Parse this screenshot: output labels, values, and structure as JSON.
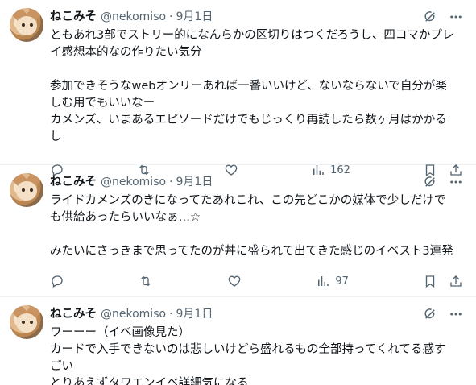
{
  "tweets": [
    {
      "name": "ねこみそ",
      "handle": "@nekomiso",
      "dot": "·",
      "date": "9月1日",
      "text": "ともあれ3部でストリー的になんらかの区切りはつくだろうし、四コマかプレイ感想本的なの作りたい気分\n\n参加できそうなwebオンリーあれば一番いいけど、ないならないで自分が楽しむ用でもいいなー\nカメンズ、いまあるエピソードだけでもじっくり再読したら数ヶ月はかかるし",
      "views": "162"
    },
    {
      "name": "ねこみそ",
      "handle": "@nekomiso",
      "dot": "·",
      "date": "9月1日",
      "text": "ライドカメンズのきになってたあれこれ、この先どこかの媒体で少しだけでも供給あったらいいなぁ…☆\n\nみたいにさっきまで思ってたのが丼に盛られて出てきた感じのイベスト3連発",
      "views": "97"
    },
    {
      "name": "ねこみそ",
      "handle": "@nekomiso",
      "dot": "·",
      "date": "9月1日",
      "text": "ワーーー（イベ画像見た）\nカードで入手できないのは悲しいけどら盛れるもの全部持ってくれてる感すごい\nとりあえずタワエンイベ詳細気になる",
      "views": ""
    }
  ]
}
